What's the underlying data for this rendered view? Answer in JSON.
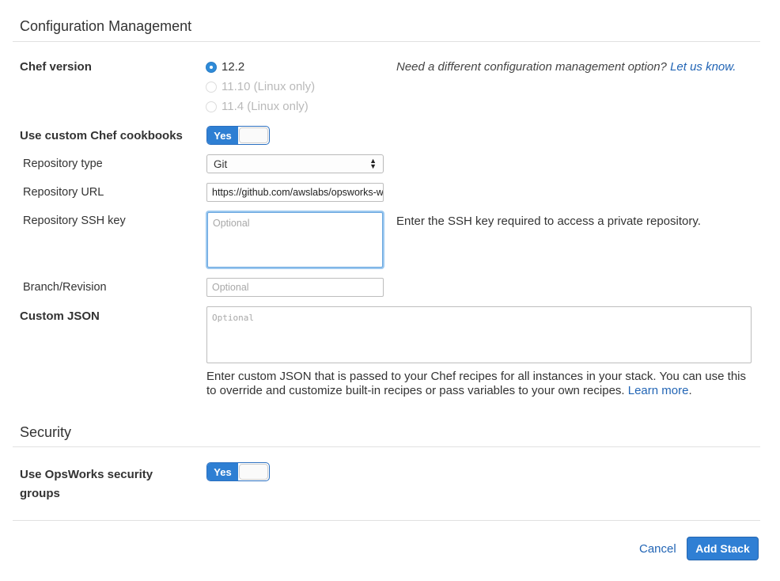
{
  "config": {
    "section_title": "Configuration Management",
    "chef_version": {
      "label": "Chef version",
      "options": [
        {
          "label": "12.2",
          "checked": true,
          "disabled": false
        },
        {
          "label": "11.10 (Linux only)",
          "checked": false,
          "disabled": true
        },
        {
          "label": "11.4 (Linux only)",
          "checked": false,
          "disabled": true
        }
      ],
      "hint_text": "Need a different configuration management option? ",
      "hint_link": "Let us know."
    },
    "custom_cookbooks": {
      "label": "Use custom Chef cookbooks",
      "toggle_label": "Yes",
      "toggle_on": true
    },
    "repository_type": {
      "label": "Repository type",
      "value": "Git"
    },
    "repository_url": {
      "label": "Repository URL",
      "value": "https://github.com/awslabs/opsworks-windows-demo-cookbooks.git"
    },
    "repository_ssh_key": {
      "label": "Repository SSH key",
      "placeholder": "Optional",
      "help": "Enter the SSH key required to access a private repository."
    },
    "branch_revision": {
      "label": "Branch/Revision",
      "placeholder": "Optional"
    },
    "custom_json": {
      "label": "Custom JSON",
      "placeholder": "Optional",
      "help_line1": "Enter custom JSON that is passed to your Chef recipes for all instances in your stack. You can use this",
      "help_line2": "to override and customize built-in recipes or pass variables to your own recipes. ",
      "help_link": "Learn more",
      "help_end": "."
    }
  },
  "security": {
    "section_title": "Security",
    "opsworks_groups": {
      "label_line1": "Use OpsWorks security",
      "label_line2": "groups",
      "toggle_label": "Yes",
      "toggle_on": true
    }
  },
  "footer": {
    "cancel_label": "Cancel",
    "submit_label": "Add Stack"
  },
  "colors": {
    "accent": "#2e7fd3",
    "link": "#2265b5"
  }
}
